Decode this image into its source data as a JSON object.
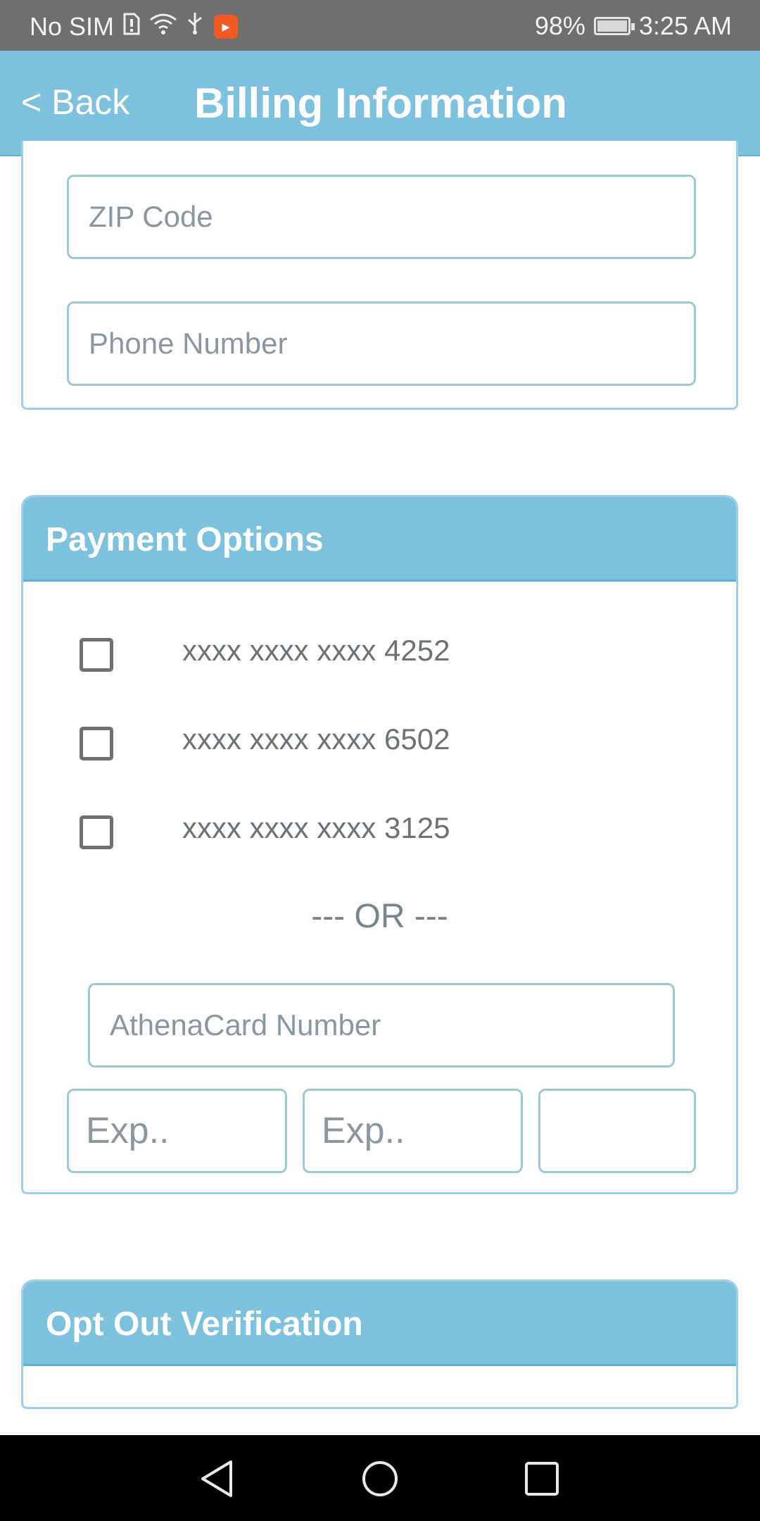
{
  "status_bar": {
    "carrier": "No SIM",
    "battery_percent": "98%",
    "time": "3:25 AM",
    "icons": [
      "sim-alert-icon",
      "wifi-icon",
      "usb-icon",
      "app-notification-icon",
      "battery-charging-icon"
    ]
  },
  "header": {
    "back_label": "< Back",
    "title": "Billing Information"
  },
  "address_form": {
    "zip_placeholder": "ZIP Code",
    "phone_placeholder": "Phone Number"
  },
  "payment": {
    "section_title": "Payment Options",
    "saved_cards": [
      {
        "label": "xxxx xxxx xxxx 4252",
        "checked": false
      },
      {
        "label": "xxxx xxxx xxxx 6502",
        "checked": false
      },
      {
        "label": "xxxx xxxx xxxx 3125",
        "checked": false
      }
    ],
    "or_separator": "--- OR ---",
    "card_number_placeholder": "AthenaCard Number",
    "exp_month_placeholder": "Exp..",
    "exp_year_placeholder": "Exp..",
    "cvv_placeholder": ""
  },
  "opt_out": {
    "section_title": "Opt Out Verification"
  },
  "colors": {
    "accent": "#7cc1dd",
    "border": "#9cd0ea",
    "status_bar": "#6f6f6f",
    "nav_bar": "#000000"
  }
}
